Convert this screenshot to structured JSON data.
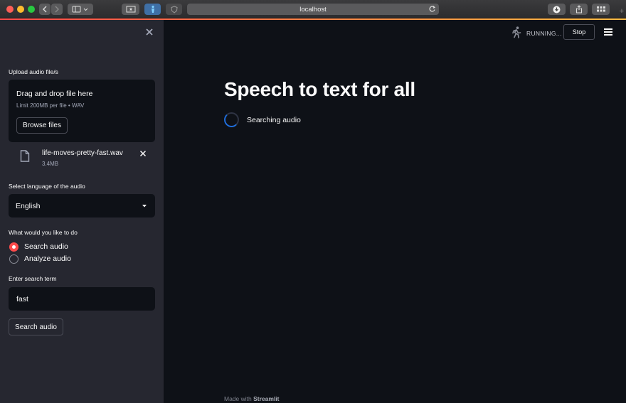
{
  "browser": {
    "url": "localhost"
  },
  "sidebar": {
    "upload_label": "Upload audio file/s",
    "uploader": {
      "title": "Drag and drop file here",
      "subtitle": "Limit 200MB per file • WAV",
      "browse_label": "Browse files"
    },
    "file": {
      "name": "life-moves-pretty-fast.wav",
      "size": "3.4MB"
    },
    "language_label": "Select language of the audio",
    "language_value": "English",
    "action_label": "What would you like to do",
    "actions": [
      {
        "label": "Search audio",
        "selected": true
      },
      {
        "label": "Analyze audio",
        "selected": false
      }
    ],
    "search_label": "Enter search term",
    "search_value": "fast",
    "search_button": "Search audio"
  },
  "header": {
    "status": "RUNNING...",
    "stop_label": "Stop"
  },
  "main": {
    "title": "Speech to text for all",
    "spinner_text": "Searching audio"
  },
  "footer": {
    "prefix": "Made with",
    "brand": "Streamlit"
  },
  "colors": {
    "accent": "#ff4b4b",
    "sidebar_bg": "#262730",
    "main_bg": "#0e1117",
    "spinner": "#1f6cd9"
  }
}
